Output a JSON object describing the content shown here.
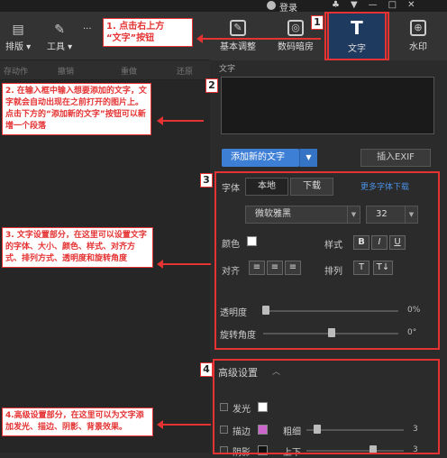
{
  "titlebar": {
    "login": "登录",
    "icons": [
      "♣",
      "▼",
      "—",
      "□",
      "✕"
    ]
  },
  "toolbar": {
    "items": [
      {
        "label": "排版",
        "icon": "layout-icon"
      },
      {
        "label": "工具",
        "icon": "wrench-icon"
      }
    ],
    "more": "···",
    "sub_items": [
      "存动作",
      "撤销",
      "重做",
      "还原"
    ]
  },
  "tabs": [
    {
      "label": "基本调整",
      "icon": "edit-icon",
      "glyph": "✎"
    },
    {
      "label": "数码暗房",
      "icon": "camera-icon",
      "glyph": "◎"
    },
    {
      "label": "文字",
      "icon": "text-icon",
      "glyph": "T",
      "active": true
    },
    {
      "label": "水印",
      "icon": "watermark-icon",
      "glyph": "⊕"
    }
  ],
  "panel": {
    "section_label": "文字",
    "add_button": "添加新的文字",
    "exif_button": "插入EXIF",
    "font": {
      "label": "字体",
      "local": "本地",
      "download": "下载",
      "more_link": "更多字体下载",
      "family": "微软雅黑",
      "size": "32"
    },
    "color_label": "颜色",
    "style_label": "样式",
    "style_buttons": [
      "B",
      "I",
      "U"
    ],
    "align_label": "对齐",
    "align_buttons": [
      "≡",
      "≡",
      "≡"
    ],
    "arrange_label": "排列",
    "arrange_buttons": [
      "T",
      "T↓"
    ],
    "opacity": {
      "label": "透明度",
      "value": "0%"
    },
    "rotation": {
      "label": "旋转角度",
      "value": "0°"
    },
    "advanced": {
      "title": "高级设置",
      "glow": "发光",
      "stroke": "描边",
      "thickness": "粗细",
      "thickness_value": "3",
      "shadow": "阴影",
      "shadow_pos": "上下",
      "shadow_value": "3"
    }
  },
  "annotations": {
    "num1": "1",
    "num2": "2",
    "num3": "3",
    "num4": "4",
    "note1": "1. 点击右上方\n“文字”按钮",
    "note2": "2. 在输入框中输入想要添加的文字，文字就会自动出现在之前打开的图片上。点击下方的“添加新的文字”按钮可以新增一个段落",
    "note3": "3. 文字设置部分，在这里可以设置文字的字体、大小、颜色、样式、对齐方式、排列方式、透明度和旋转角度",
    "note4": "4.高级设置部分，在这里可以为文字添加发光、描边、阴影、背景效果。"
  },
  "colors": {
    "accent": "#3e7fd6",
    "annotation": "#e53333",
    "stroke_swatch": "#cc66cc"
  }
}
